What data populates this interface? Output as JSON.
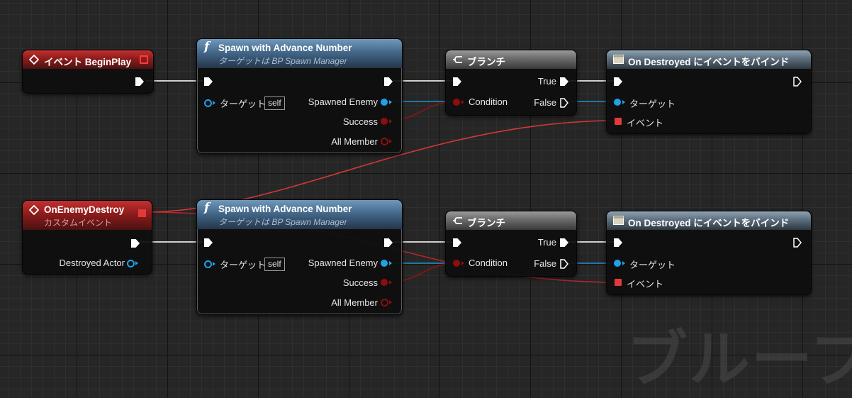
{
  "watermark": "ブループ",
  "nodes": {
    "begin_play": {
      "title": "イベント BeginPlay"
    },
    "spawn1": {
      "title": "Spawn with Advance Number",
      "subtitle": "ターゲットは BP Spawn Manager",
      "target_label": "ターゲット",
      "target_value": "self",
      "out1": "Spawned Enemy",
      "out2": "Success",
      "out3": "All Member"
    },
    "branch1": {
      "title": "ブランチ",
      "true_label": "True",
      "false_label": "False",
      "condition_label": "Condition"
    },
    "bind1": {
      "title": "On Destroyed にイベントをバインド",
      "target_label": "ターゲット",
      "event_label": "イベント"
    },
    "custom_event": {
      "title": "OnEnemyDestroy",
      "subtitle": "カスタムイベント",
      "param": "Destroyed Actor"
    },
    "spawn2": {
      "title": "Spawn with Advance Number",
      "subtitle": "ターゲットは BP Spawn Manager",
      "target_label": "ターゲット",
      "target_value": "self",
      "out1": "Spawned Enemy",
      "out2": "Success",
      "out3": "All Member"
    },
    "branch2": {
      "title": "ブランチ",
      "true_label": "True",
      "false_label": "False",
      "condition_label": "Condition"
    },
    "bind2": {
      "title": "On Destroyed にイベントをバインド",
      "target_label": "ターゲット",
      "event_label": "イベント"
    }
  },
  "colors": {
    "exec": "#ffffff",
    "object": "#1fa2e6",
    "bool": "#8c0e0e",
    "delegate": "#e23a3a",
    "event_header": "#8e1c1c",
    "function_header": "#44688a"
  },
  "icons": {
    "event": "diamond-event-icon",
    "function": "function-f-icon",
    "branch": "branch-icon",
    "bind": "bind-delegate-icon"
  }
}
